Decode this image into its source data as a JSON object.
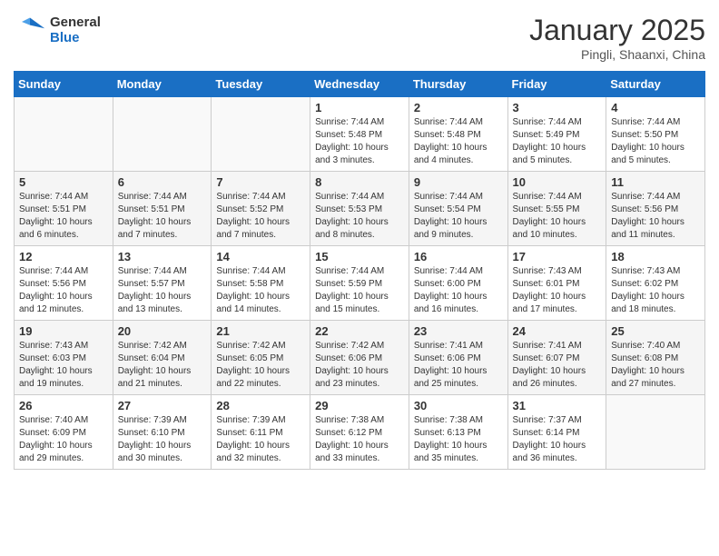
{
  "header": {
    "logo_line1": "General",
    "logo_line2": "Blue",
    "month_year": "January 2025",
    "location": "Pingli, Shaanxi, China"
  },
  "days_of_week": [
    "Sunday",
    "Monday",
    "Tuesday",
    "Wednesday",
    "Thursday",
    "Friday",
    "Saturday"
  ],
  "weeks": [
    [
      {
        "day": "",
        "info": ""
      },
      {
        "day": "",
        "info": ""
      },
      {
        "day": "",
        "info": ""
      },
      {
        "day": "1",
        "info": "Sunrise: 7:44 AM\nSunset: 5:48 PM\nDaylight: 10 hours and 3 minutes."
      },
      {
        "day": "2",
        "info": "Sunrise: 7:44 AM\nSunset: 5:48 PM\nDaylight: 10 hours and 4 minutes."
      },
      {
        "day": "3",
        "info": "Sunrise: 7:44 AM\nSunset: 5:49 PM\nDaylight: 10 hours and 5 minutes."
      },
      {
        "day": "4",
        "info": "Sunrise: 7:44 AM\nSunset: 5:50 PM\nDaylight: 10 hours and 5 minutes."
      }
    ],
    [
      {
        "day": "5",
        "info": "Sunrise: 7:44 AM\nSunset: 5:51 PM\nDaylight: 10 hours and 6 minutes."
      },
      {
        "day": "6",
        "info": "Sunrise: 7:44 AM\nSunset: 5:51 PM\nDaylight: 10 hours and 7 minutes."
      },
      {
        "day": "7",
        "info": "Sunrise: 7:44 AM\nSunset: 5:52 PM\nDaylight: 10 hours and 7 minutes."
      },
      {
        "day": "8",
        "info": "Sunrise: 7:44 AM\nSunset: 5:53 PM\nDaylight: 10 hours and 8 minutes."
      },
      {
        "day": "9",
        "info": "Sunrise: 7:44 AM\nSunset: 5:54 PM\nDaylight: 10 hours and 9 minutes."
      },
      {
        "day": "10",
        "info": "Sunrise: 7:44 AM\nSunset: 5:55 PM\nDaylight: 10 hours and 10 minutes."
      },
      {
        "day": "11",
        "info": "Sunrise: 7:44 AM\nSunset: 5:56 PM\nDaylight: 10 hours and 11 minutes."
      }
    ],
    [
      {
        "day": "12",
        "info": "Sunrise: 7:44 AM\nSunset: 5:56 PM\nDaylight: 10 hours and 12 minutes."
      },
      {
        "day": "13",
        "info": "Sunrise: 7:44 AM\nSunset: 5:57 PM\nDaylight: 10 hours and 13 minutes."
      },
      {
        "day": "14",
        "info": "Sunrise: 7:44 AM\nSunset: 5:58 PM\nDaylight: 10 hours and 14 minutes."
      },
      {
        "day": "15",
        "info": "Sunrise: 7:44 AM\nSunset: 5:59 PM\nDaylight: 10 hours and 15 minutes."
      },
      {
        "day": "16",
        "info": "Sunrise: 7:44 AM\nSunset: 6:00 PM\nDaylight: 10 hours and 16 minutes."
      },
      {
        "day": "17",
        "info": "Sunrise: 7:43 AM\nSunset: 6:01 PM\nDaylight: 10 hours and 17 minutes."
      },
      {
        "day": "18",
        "info": "Sunrise: 7:43 AM\nSunset: 6:02 PM\nDaylight: 10 hours and 18 minutes."
      }
    ],
    [
      {
        "day": "19",
        "info": "Sunrise: 7:43 AM\nSunset: 6:03 PM\nDaylight: 10 hours and 19 minutes."
      },
      {
        "day": "20",
        "info": "Sunrise: 7:42 AM\nSunset: 6:04 PM\nDaylight: 10 hours and 21 minutes."
      },
      {
        "day": "21",
        "info": "Sunrise: 7:42 AM\nSunset: 6:05 PM\nDaylight: 10 hours and 22 minutes."
      },
      {
        "day": "22",
        "info": "Sunrise: 7:42 AM\nSunset: 6:06 PM\nDaylight: 10 hours and 23 minutes."
      },
      {
        "day": "23",
        "info": "Sunrise: 7:41 AM\nSunset: 6:06 PM\nDaylight: 10 hours and 25 minutes."
      },
      {
        "day": "24",
        "info": "Sunrise: 7:41 AM\nSunset: 6:07 PM\nDaylight: 10 hours and 26 minutes."
      },
      {
        "day": "25",
        "info": "Sunrise: 7:40 AM\nSunset: 6:08 PM\nDaylight: 10 hours and 27 minutes."
      }
    ],
    [
      {
        "day": "26",
        "info": "Sunrise: 7:40 AM\nSunset: 6:09 PM\nDaylight: 10 hours and 29 minutes."
      },
      {
        "day": "27",
        "info": "Sunrise: 7:39 AM\nSunset: 6:10 PM\nDaylight: 10 hours and 30 minutes."
      },
      {
        "day": "28",
        "info": "Sunrise: 7:39 AM\nSunset: 6:11 PM\nDaylight: 10 hours and 32 minutes."
      },
      {
        "day": "29",
        "info": "Sunrise: 7:38 AM\nSunset: 6:12 PM\nDaylight: 10 hours and 33 minutes."
      },
      {
        "day": "30",
        "info": "Sunrise: 7:38 AM\nSunset: 6:13 PM\nDaylight: 10 hours and 35 minutes."
      },
      {
        "day": "31",
        "info": "Sunrise: 7:37 AM\nSunset: 6:14 PM\nDaylight: 10 hours and 36 minutes."
      },
      {
        "day": "",
        "info": ""
      }
    ]
  ]
}
